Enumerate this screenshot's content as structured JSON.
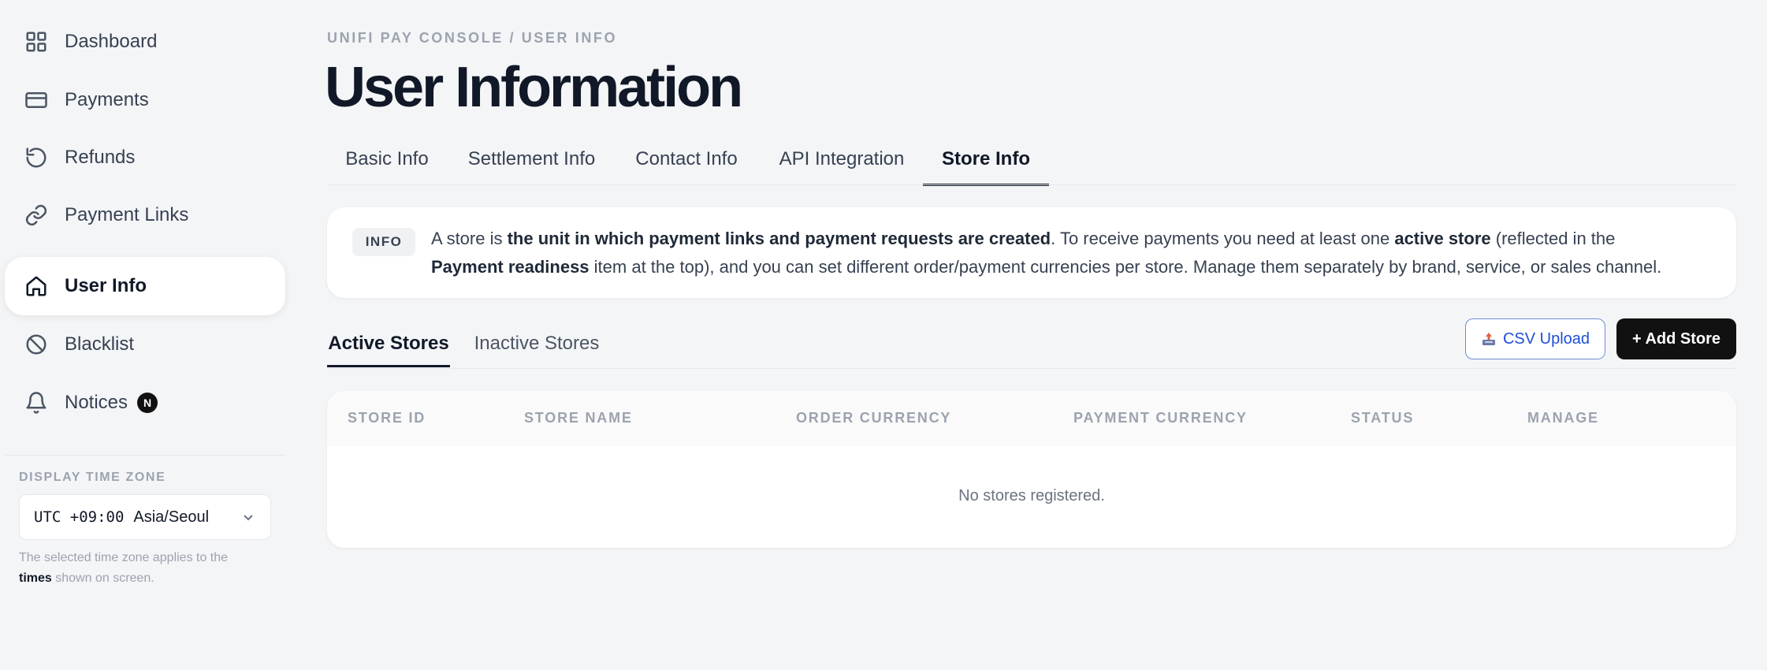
{
  "sidebar": {
    "items": [
      {
        "label": "Dashboard",
        "icon": "grid-icon"
      },
      {
        "label": "Payments",
        "icon": "card-icon"
      },
      {
        "label": "Refunds",
        "icon": "refresh-icon"
      },
      {
        "label": "Payment Links",
        "icon": "link-icon"
      },
      {
        "label": "User Info",
        "icon": "home-icon",
        "active": true
      },
      {
        "label": "Blacklist",
        "icon": "ban-icon"
      },
      {
        "label": "Notices",
        "icon": "bell-icon",
        "badge": "N"
      }
    ],
    "timezone": {
      "label": "DISPLAY TIME ZONE",
      "offset": "UTC +09:00",
      "zone": "Asia/Seoul",
      "note_pre": "The selected time zone applies to the",
      "note_bold": "times",
      "note_post": "shown on screen."
    }
  },
  "header": {
    "breadcrumb": "UNIFI PAY CONSOLE / USER INFO",
    "title": "User Information"
  },
  "tabs": [
    "Basic Info",
    "Settlement Info",
    "Contact Info",
    "API Integration",
    "Store Info"
  ],
  "active_tab": "Store Info",
  "info": {
    "tag": "INFO",
    "t1": "A store is ",
    "b1": "the unit in which payment links and payment requests are created",
    "t2": ". To receive payments you need at least one ",
    "b2": "active store",
    "t3": " (reflected in the ",
    "b3": "Payment readiness",
    "t4": " item at the top), and you can set different order/payment currencies per store. Manage them separately by brand, service, or sales channel."
  },
  "subtabs": [
    "Active Stores",
    "Inactive Stores"
  ],
  "buttons": {
    "csv_upload": "CSV Upload",
    "add_store": "+ Add Store"
  },
  "table": {
    "columns": [
      "STORE ID",
      "STORE NAME",
      "ORDER CURRENCY",
      "PAYMENT CURRENCY",
      "STATUS",
      "MANAGE"
    ],
    "empty_text": "No stores registered."
  },
  "colors": {
    "accent": "#111111",
    "link_blue": "#1d4ed8",
    "muted": "#9ca3af",
    "background": "#f4f5f7"
  }
}
